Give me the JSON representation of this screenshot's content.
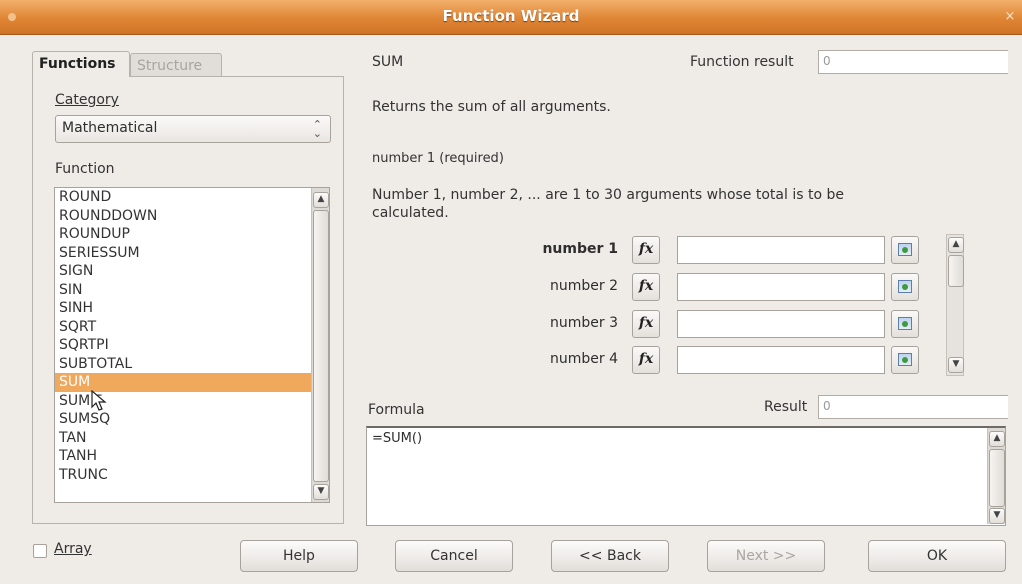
{
  "window": {
    "title": "Function Wizard",
    "close_glyph": "×"
  },
  "tabs": [
    {
      "label": "Functions",
      "active": true
    },
    {
      "label": "Structure",
      "active": false
    }
  ],
  "left": {
    "category_label": "Category",
    "category_value": "Mathematical",
    "function_label": "Function",
    "functions": [
      "ROUND",
      "ROUNDDOWN",
      "ROUNDUP",
      "SERIESSUM",
      "SIGN",
      "SIN",
      "SINH",
      "SQRT",
      "SQRTPI",
      "SUBTOTAL",
      "SUM",
      "SUMIF",
      "SUMSQ",
      "TAN",
      "TANH",
      "TRUNC"
    ],
    "selected": "SUM"
  },
  "right": {
    "function_name": "SUM",
    "function_result_label": "Function result",
    "function_result_value": "0",
    "description": "Returns the sum of all arguments.",
    "arg_heading": "number 1 (required)",
    "arg_description_line1": "Number 1, number 2, ... are 1 to 30 arguments whose total is to be",
    "arg_description_line2": "calculated.",
    "args": [
      {
        "label": "number 1",
        "value": "",
        "bold": true
      },
      {
        "label": "number 2",
        "value": "",
        "bold": false
      },
      {
        "label": "number 3",
        "value": "",
        "bold": false
      },
      {
        "label": "number 4",
        "value": "",
        "bold": false
      }
    ],
    "fx_glyph": "fx",
    "formula_label": "Formula",
    "result_label": "Result",
    "result_value": "0",
    "formula_text": "=SUM()"
  },
  "footer": {
    "array_label": "Array",
    "help": "Help",
    "cancel": "Cancel",
    "back": "<< Back",
    "next": "Next >>",
    "ok": "OK"
  },
  "icons": {
    "scroll_up": "▲",
    "scroll_down": "▼",
    "combo_arrows": "⌃⌄"
  },
  "colors": {
    "titlebar": "#df8534",
    "selection": "#f0a85c"
  }
}
